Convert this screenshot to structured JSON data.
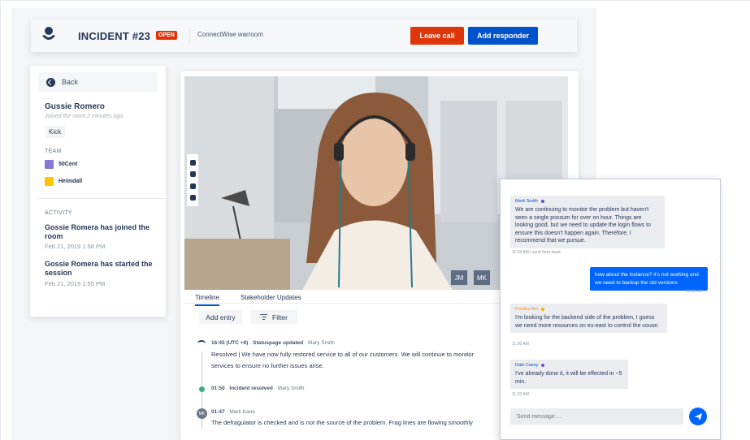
{
  "header": {
    "title": "INCIDENT #23",
    "status_badge": "OPEN",
    "warroom": "ConnectWise warroom",
    "leave_label": "Leave call",
    "add_responder_label": "Add responder",
    "accent": "#0052CC",
    "danger": "#DE350B"
  },
  "sidebar": {
    "back_label": "Back",
    "user_name": "Gussie Romero",
    "joined_text": "Joined the room 2 minutes ago.",
    "kick_label": "Kick",
    "team_heading": "TEAM",
    "teams": [
      {
        "name": "50Cent",
        "color": "#8777D9"
      },
      {
        "name": "Heimdall",
        "color": "#FFC400"
      }
    ],
    "activity_heading": "ACTIVITY",
    "activity": [
      {
        "title": "Gossie Romera has joined the room",
        "time": "Feb 21, 2019 1:58 PM"
      },
      {
        "title": "Gossie Romera has started the session",
        "time": "Feb 21, 2019 1:55 PM"
      }
    ]
  },
  "video": {
    "participants": [
      "JM",
      "MK"
    ]
  },
  "timeline": {
    "tabs": [
      "Timeline",
      "Stakeholder Updates"
    ],
    "add_entry_label": "Add entry",
    "filter_label": "Filter",
    "entries": [
      {
        "time": "16:45 (UTC +8)",
        "event": "Statuspage updated",
        "author": "Mary Smith",
        "text1": "Resolved | We have now fully restored service to all of our customers. We will continue to monitor",
        "text2": "services to ensure no further issues arise."
      },
      {
        "time": "01:50",
        "event": "Incident resolved",
        "author": "Mary Smith"
      },
      {
        "time": "01:47",
        "author": "Mark Kane",
        "text1": "The defragulator is checked and is not the source of the problem. Frag lines are flowing smoothly"
      }
    ]
  },
  "chat": {
    "messages": [
      {
        "sender": "Mark Smith",
        "text": "We are continuing to monitor the problem but haven't seen a single possum for over on hour. Things are looking good, but we need to update the login flows to ensure this doesn't happen again. Therefore, I recommend that we pursue.",
        "meta": "11:33 AM  |  send form slack"
      },
      {
        "mine": true,
        "text": "how about the instance? it's not working and we need to backup the old versions",
        "meta": "11:33 AM"
      },
      {
        "sender": "Proxies Bot",
        "text": "I'm looking for the backend side of the problem, I guess we need more resources on eu-east to control the couse.",
        "meta": "11:36 AM"
      },
      {
        "sender": "Dale Casey",
        "text": "I've already done it, it will be effected in ~5 min.",
        "meta": "11:33 AM"
      }
    ],
    "input_placeholder": "Send message ..."
  }
}
